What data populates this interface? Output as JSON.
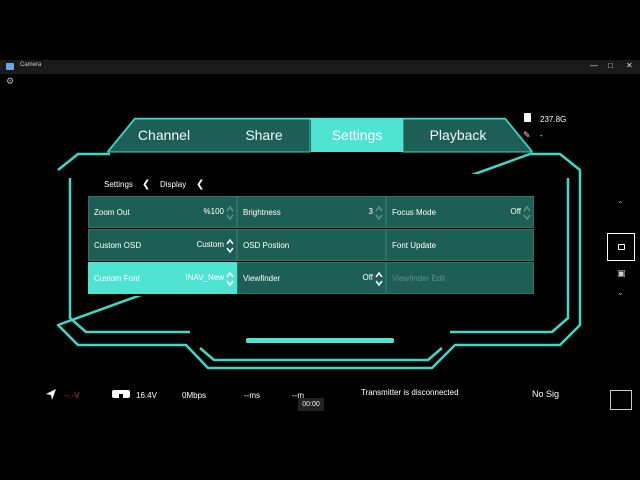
{
  "window": {
    "title": "Camera",
    "controls": {
      "minimize": "—",
      "maximize": "□",
      "close": "✕"
    }
  },
  "tabs": [
    {
      "label": "Channel",
      "active": false
    },
    {
      "label": "Share",
      "active": false
    },
    {
      "label": "Settings",
      "active": true
    },
    {
      "label": "Playback",
      "active": false
    }
  ],
  "storage": {
    "capacity": "237.8G",
    "secondary": "-"
  },
  "breadcrumb": {
    "level1": "Settings",
    "level2": "Display"
  },
  "grid": [
    {
      "label": "Zoom Out",
      "value": "%100",
      "dim": true,
      "active": false,
      "stepper": true
    },
    {
      "label": "Brightness",
      "value": "3",
      "dim": true,
      "active": false,
      "stepper": true
    },
    {
      "label": "Focus Mode",
      "value": "Off",
      "dim": true,
      "active": false,
      "stepper": true
    },
    {
      "label": "Custom OSD",
      "value": "Custom",
      "dim": false,
      "active": false,
      "stepper": true
    },
    {
      "label": "OSD Postion",
      "value": "",
      "dim": false,
      "active": false,
      "stepper": false
    },
    {
      "label": "Font Update",
      "value": "",
      "dim": false,
      "active": false,
      "stepper": false
    },
    {
      "label": "Custom Font",
      "value": "INAV_New",
      "dim": false,
      "active": true,
      "stepper": true
    },
    {
      "label": "Viewfinder",
      "value": "Off",
      "dim": false,
      "active": false,
      "stepper": true
    },
    {
      "label": "Viewfinder Edit",
      "value": "",
      "dim": true,
      "active": false,
      "stepper": false
    }
  ],
  "status": {
    "signal_value": "--.-V",
    "battery_voltage": "16.4V",
    "bitrate": "0Mbps",
    "latency": "--ms",
    "distance": "--m",
    "transmitter": "Transmitter is disconnected",
    "no_signal": "No Sig",
    "timer": "00:00"
  },
  "colors": {
    "accent": "#4fe3d2",
    "cell_bg": "#1e5f55",
    "hud_line": "#3fd8c8"
  },
  "icons": [
    "camera-app-icon",
    "gear-icon",
    "sd-card-icon",
    "signal-icon",
    "navigation-arrow-icon",
    "goggles-icon",
    "video-camera-icon",
    "photo-camera-icon"
  ]
}
